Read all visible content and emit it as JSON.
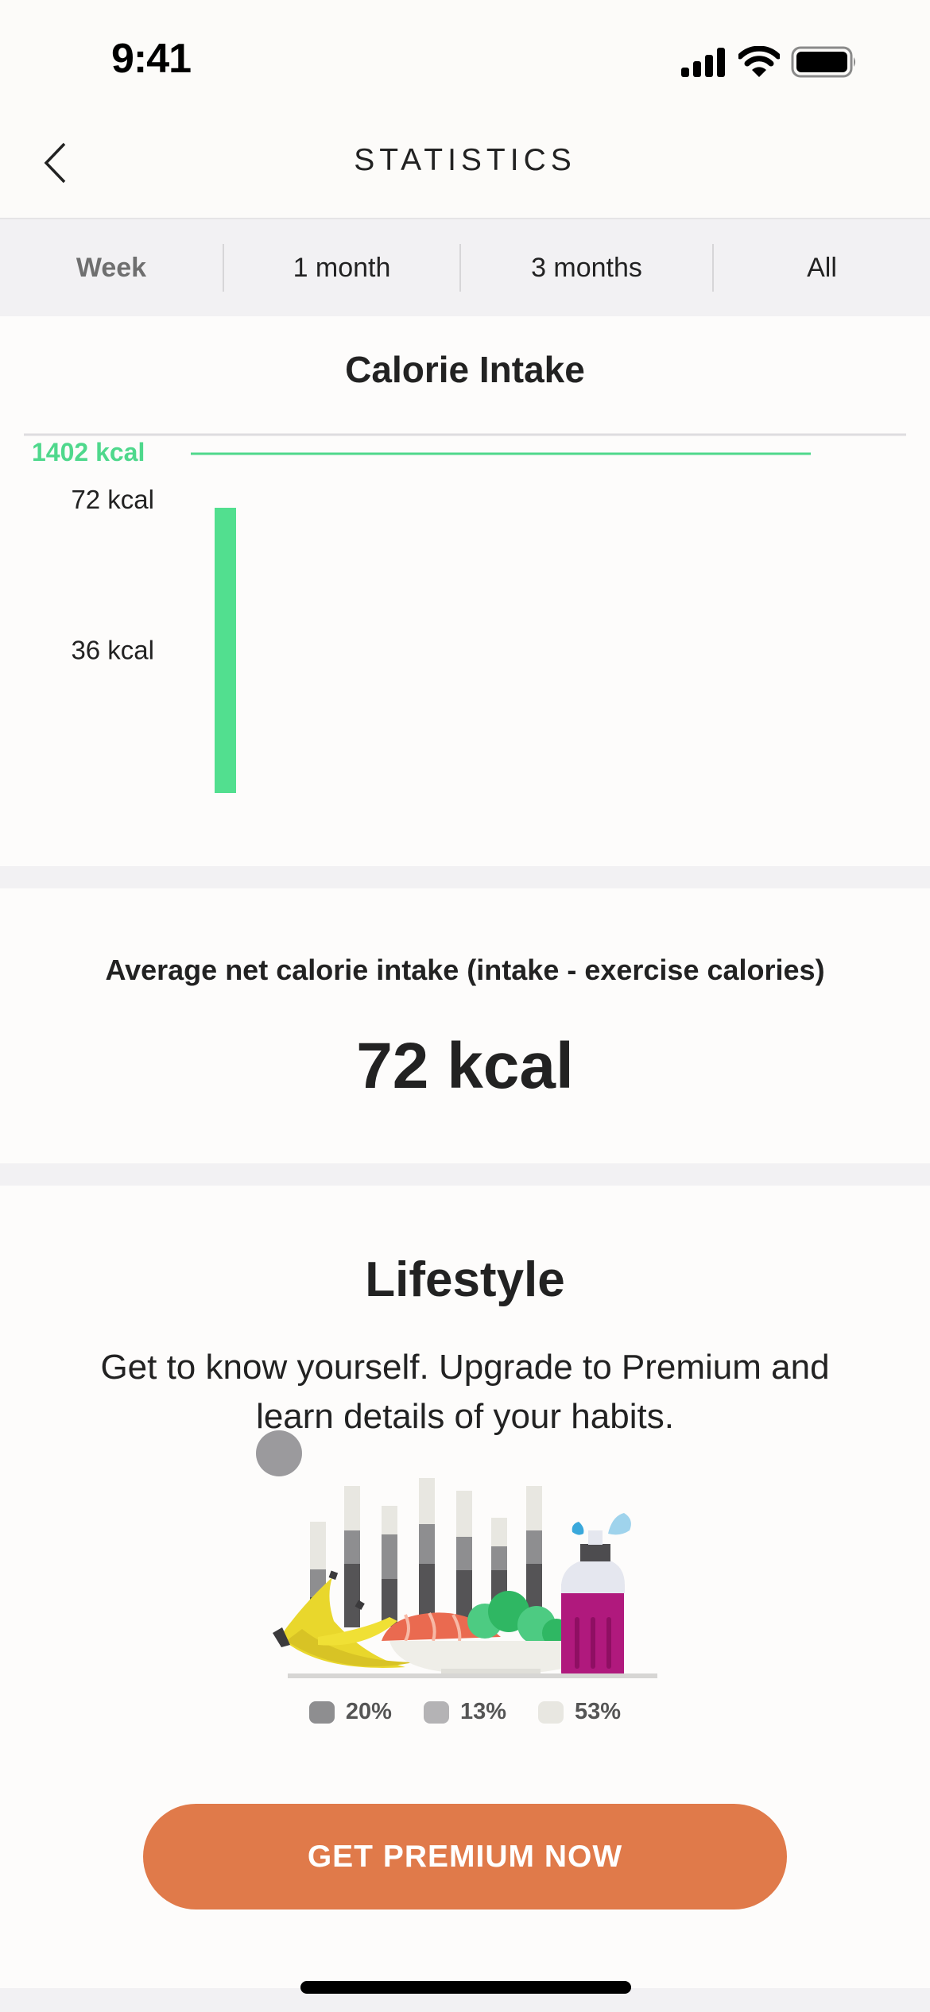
{
  "status_bar": {
    "time": "9:41",
    "icons": [
      "cellular-signal-icon",
      "wifi-icon",
      "battery-icon"
    ]
  },
  "nav": {
    "title": "STATISTICS",
    "back_icon": "chevron-left-icon"
  },
  "tabs": [
    {
      "label": "Week",
      "active": true
    },
    {
      "label": "1 month",
      "active": false
    },
    {
      "label": "3 months",
      "active": false
    },
    {
      "label": "All",
      "active": false
    }
  ],
  "calorie_chart": {
    "title": "Calorie Intake",
    "goal_label": "1402 kcal",
    "goal_color": "#4fd88c",
    "bar_color": "#52df8f"
  },
  "chart_data": {
    "type": "bar",
    "title": "Calorie Intake",
    "xlabel": "",
    "ylabel": "kcal",
    "categories": [
      "day-1"
    ],
    "values": [
      72
    ],
    "ylim": [
      0,
      72
    ],
    "yticks": [
      {
        "value": 72,
        "label": "72 kcal"
      },
      {
        "value": 36,
        "label": "36 kcal"
      }
    ],
    "reference_line": {
      "value": 1402,
      "label": "1402 kcal",
      "meaning": "daily goal"
    },
    "grid": false,
    "legend": "none"
  },
  "average": {
    "label": "Average net calorie intake (intake - exercise calories)",
    "value": "72 kcal"
  },
  "lifestyle": {
    "title": "Lifestyle",
    "description": "Get to know yourself. Upgrade to Premium and learn details of your habits.",
    "legend": [
      {
        "label": "20%",
        "color": "#8e8e90"
      },
      {
        "label": "13%",
        "color": "#b4b3b5"
      },
      {
        "label": "53%",
        "color": "#e8e7e1"
      }
    ],
    "cta_label": "GET PREMIUM NOW",
    "cta_color": "#e07a4a"
  }
}
